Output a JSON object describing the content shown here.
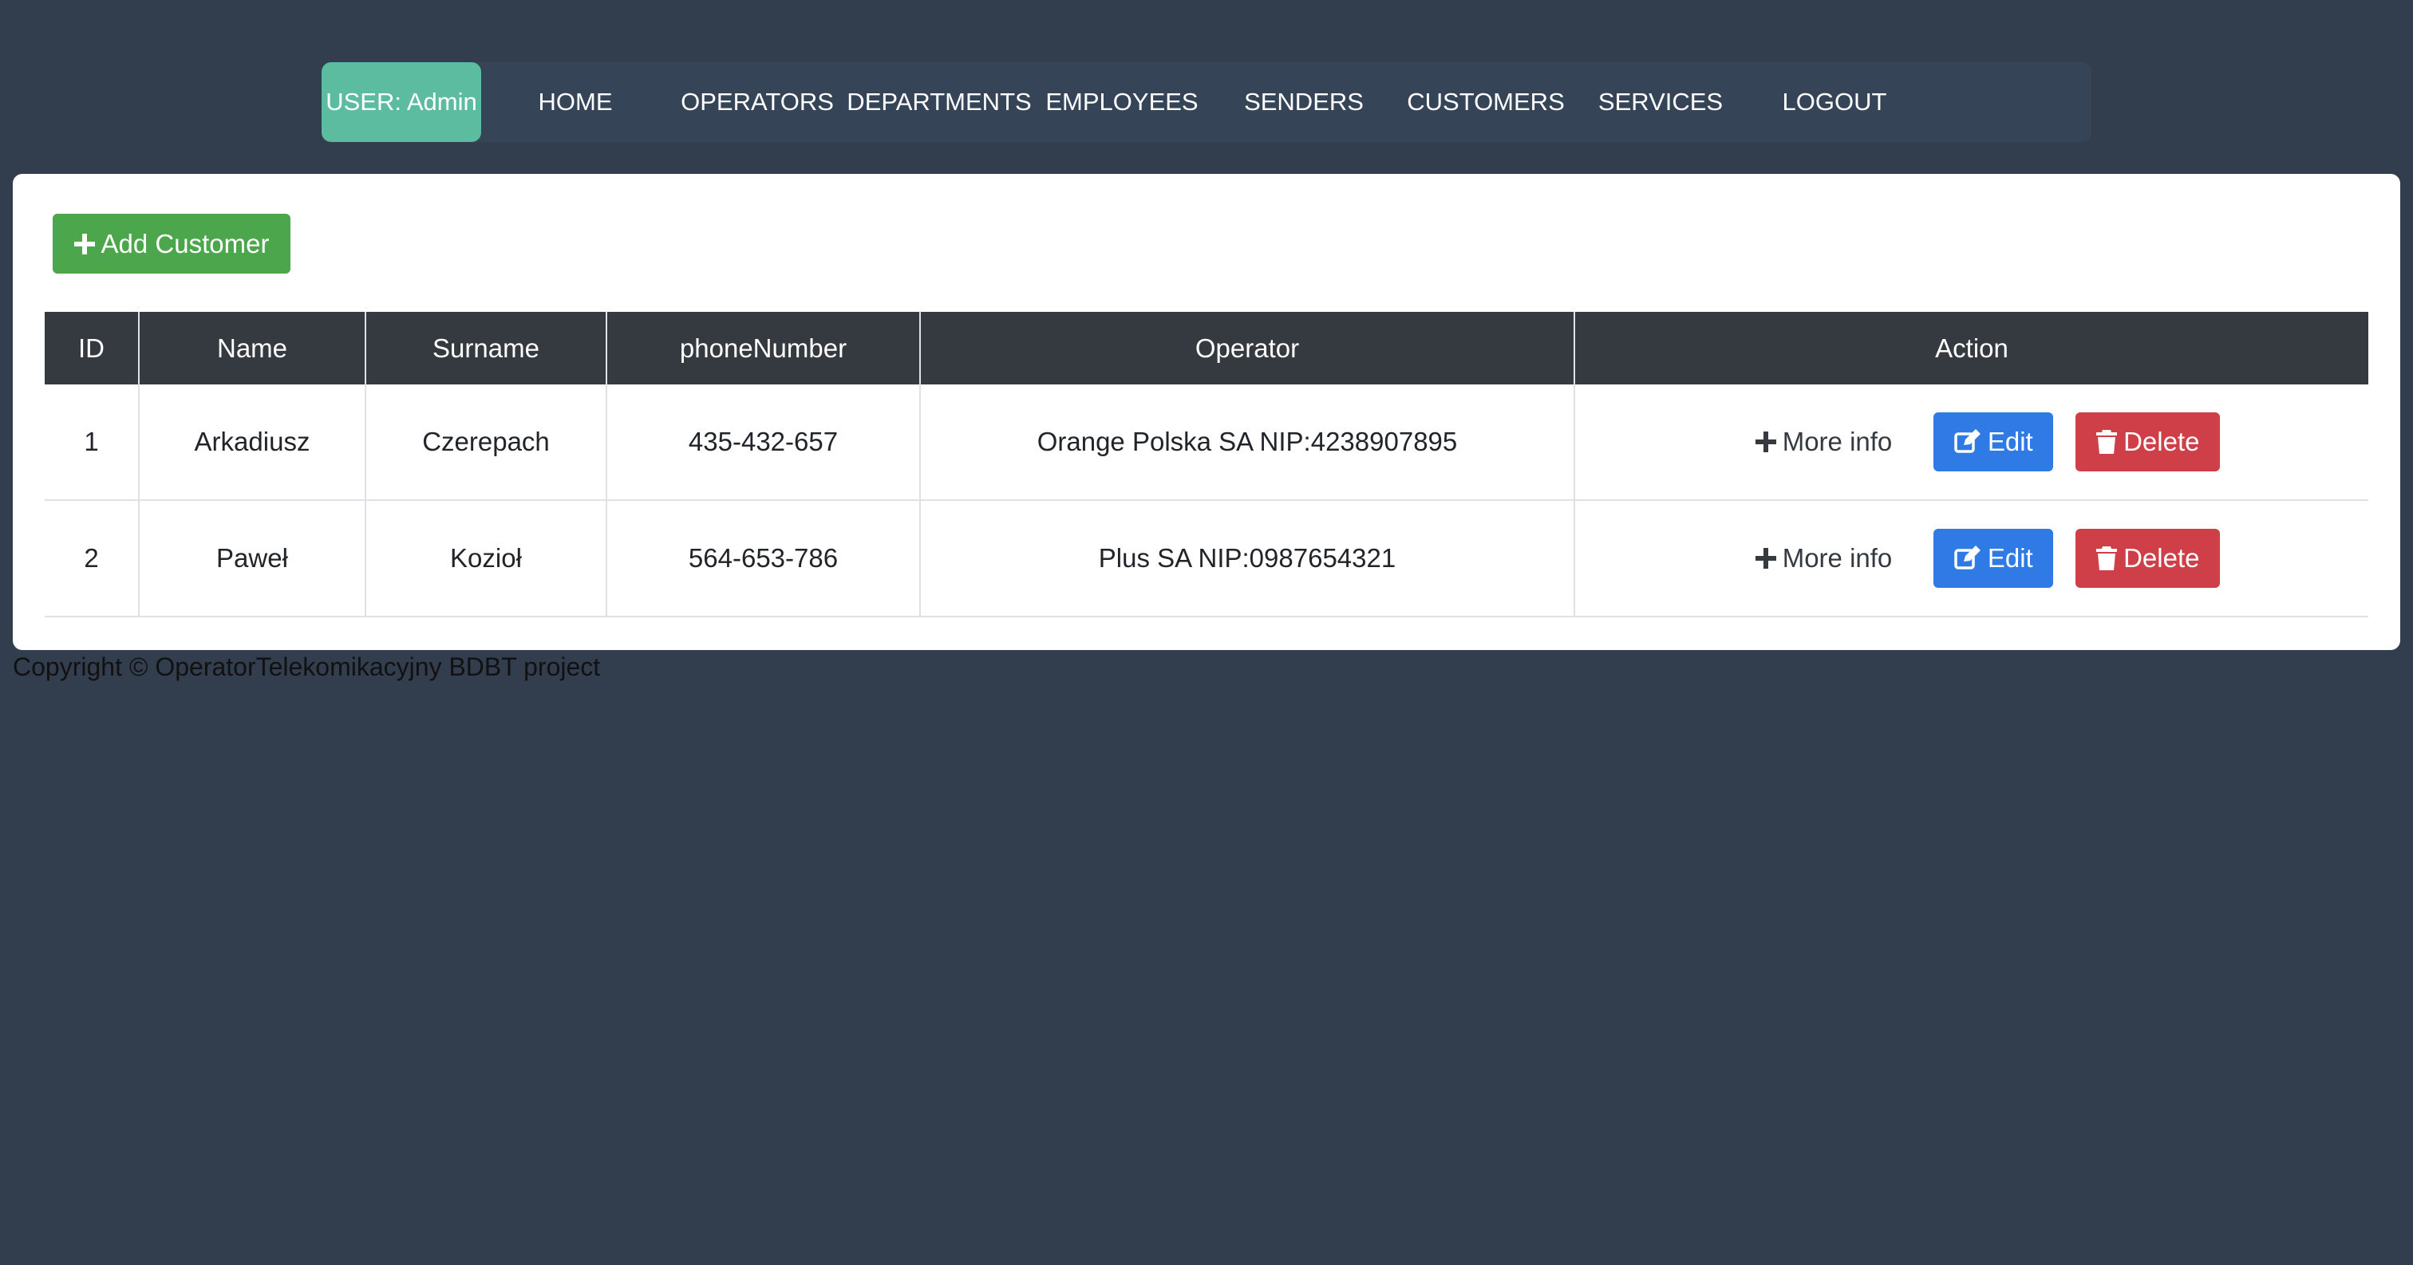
{
  "nav": {
    "user_label": "USER: Admin",
    "links": [
      {
        "label": "HOME"
      },
      {
        "label": "OPERATORS"
      },
      {
        "label": "DEPARTMENTS"
      },
      {
        "label": "EMPLOYEES"
      },
      {
        "label": "SENDERS"
      },
      {
        "label": "CUSTOMERS"
      },
      {
        "label": "SERVICES"
      },
      {
        "label": "LOGOUT"
      }
    ]
  },
  "main": {
    "add_button_label": "Add Customer",
    "table": {
      "headers": [
        "ID",
        "Name",
        "Surname",
        "phoneNumber",
        "Operator",
        "Action"
      ],
      "rows": [
        {
          "id": "1",
          "name": "Arkadiusz",
          "surname": "Czerepach",
          "phone": "435-432-657",
          "operator": "Orange Polska SA NIP:4238907895"
        },
        {
          "id": "2",
          "name": "Paweł",
          "surname": "Kozioł",
          "phone": "564-653-786",
          "operator": "Plus SA NIP:0987654321"
        }
      ],
      "actions": {
        "more_info_label": "More info",
        "edit_label": "Edit",
        "delete_label": "Delete"
      }
    }
  },
  "footer": {
    "copyright": "Copyright © OperatorTelekomikacyjny BDBT project"
  },
  "colors": {
    "page_background": "#323d4e",
    "nav_background": "#364458",
    "user_badge": "#5cbc9f",
    "add_button": "#4ca64c",
    "table_header": "#343a40",
    "edit_button": "#2f7ae5",
    "delete_button": "#cf3f47"
  },
  "icons": {
    "add": "plus-icon",
    "more_info": "plus-icon",
    "edit": "edit-icon",
    "delete": "trash-icon"
  }
}
